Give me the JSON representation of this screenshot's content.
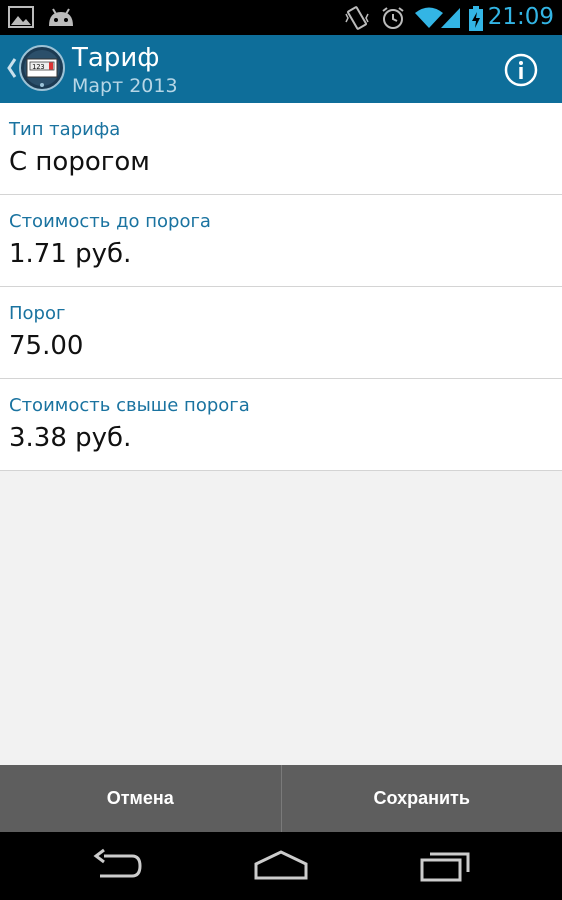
{
  "status_bar": {
    "time": "21:09",
    "icons": [
      "gallery-icon",
      "android-icon",
      "vibrate-icon",
      "alarm-icon",
      "wifi-icon",
      "signal-icon",
      "battery-charging-icon"
    ]
  },
  "action_bar": {
    "title": "Тариф",
    "subtitle": "Март 2013",
    "logo_text": "123",
    "back_icon": "chevron-left-icon",
    "info_icon": "info-icon"
  },
  "fields": [
    {
      "label": "Тип тарифа",
      "value": "С порогом"
    },
    {
      "label": "Стоимость до порога",
      "value": "1.71 руб."
    },
    {
      "label": "Порог",
      "value": "75.00"
    },
    {
      "label": "Стоимость свыше порога",
      "value": "3.38 руб."
    }
  ],
  "buttons": {
    "cancel": "Отмена",
    "save": "Сохранить"
  },
  "nav_bar": {
    "icons": [
      "back-icon",
      "home-icon",
      "recent-apps-icon"
    ]
  },
  "colors": {
    "action_bar": "#0e6e9a",
    "accent": "#33b5e5",
    "label": "#1a73a0",
    "button_bar": "#5e5e5e"
  }
}
